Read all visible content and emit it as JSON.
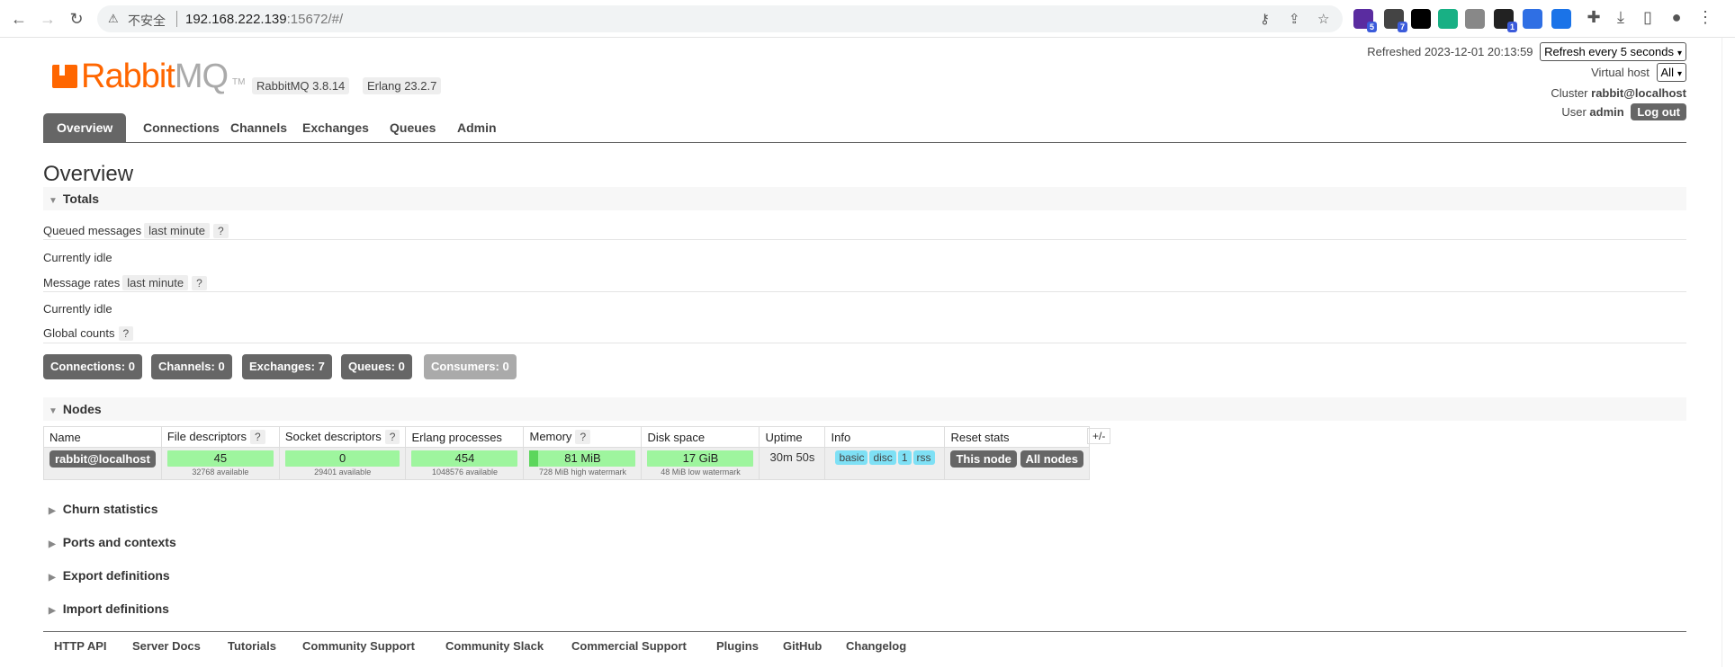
{
  "browser": {
    "warning_icon": "warning-icon",
    "insecure_label": "不安全",
    "host": "192.168.222.139",
    "path": ":15672/#/",
    "extensions": [
      {
        "name": "ext-1",
        "badge": "5",
        "color": "#5a2ca0"
      },
      {
        "name": "ext-2",
        "badge": "7",
        "color": "#444"
      },
      {
        "name": "ext-3",
        "badge": "",
        "color": "#000"
      },
      {
        "name": "ext-4",
        "badge": "",
        "color": "#18b084"
      },
      {
        "name": "ext-5",
        "badge": "",
        "color": "#888"
      },
      {
        "name": "ext-6",
        "badge": "1",
        "color": "#222"
      },
      {
        "name": "ext-7",
        "badge": "",
        "color": "#2f6fe4"
      },
      {
        "name": "ext-8",
        "badge": "",
        "color": "#1a73e8"
      }
    ]
  },
  "header": {
    "logo_rabbit": "Rabbit",
    "logo_mq": "MQ",
    "logo_tm": "TM",
    "rabbitmq_version": "RabbitMQ 3.8.14",
    "erlang_version": "Erlang 23.2.7",
    "refreshed_label": "Refreshed 2023-12-01 20:13:59",
    "refresh_select": "Refresh every 5 seconds",
    "virtual_host_label": "Virtual host",
    "virtual_host_value": "All",
    "cluster_label": "Cluster",
    "cluster_value": "rabbit@localhost",
    "user_label": "User",
    "user_value": "admin",
    "logout_label": "Log out"
  },
  "tabs": [
    "Overview",
    "Connections",
    "Channels",
    "Exchanges",
    "Queues",
    "Admin"
  ],
  "page_title": "Overview",
  "totals": {
    "heading": "Totals",
    "queued_messages_label": "Queued messages",
    "queued_range": "last minute",
    "help": "?",
    "idle1": "Currently idle",
    "message_rates_label": "Message rates",
    "rates_range": "last minute",
    "idle2": "Currently idle",
    "global_counts_label": "Global counts"
  },
  "counts": [
    {
      "label": "Connections:",
      "value": "0"
    },
    {
      "label": "Channels:",
      "value": "0"
    },
    {
      "label": "Exchanges:",
      "value": "7"
    },
    {
      "label": "Queues:",
      "value": "0"
    },
    {
      "label": "Consumers:",
      "value": "0"
    }
  ],
  "nodes": {
    "heading": "Nodes",
    "columns": [
      "Name",
      "File descriptors",
      "Socket descriptors",
      "Erlang processes",
      "Memory",
      "Disk space",
      "Uptime",
      "Info",
      "Reset stats"
    ],
    "help_cols": [
      1,
      2,
      4
    ],
    "plus_minus": "+/-",
    "row": {
      "name": "rabbit@localhost",
      "fd_value": "45",
      "fd_sub": "32768 available",
      "sd_value": "0",
      "sd_sub": "29401 available",
      "ep_value": "454",
      "ep_sub": "1048576 available",
      "mem_value": "81 MiB",
      "mem_sub": "728 MiB high watermark",
      "disk_value": "17 GiB",
      "disk_sub": "48 MiB low watermark",
      "uptime": "30m 50s",
      "info": [
        "basic",
        "disc",
        "1",
        "rss"
      ],
      "reset_this": "This node",
      "reset_all": "All nodes"
    }
  },
  "collapsibles": [
    "Churn statistics",
    "Ports and contexts",
    "Export definitions",
    "Import definitions"
  ],
  "footer": [
    "HTTP API",
    "Server Docs",
    "Tutorials",
    "Community Support",
    "Community Slack",
    "Commercial Support",
    "Plugins",
    "GitHub",
    "Changelog"
  ]
}
